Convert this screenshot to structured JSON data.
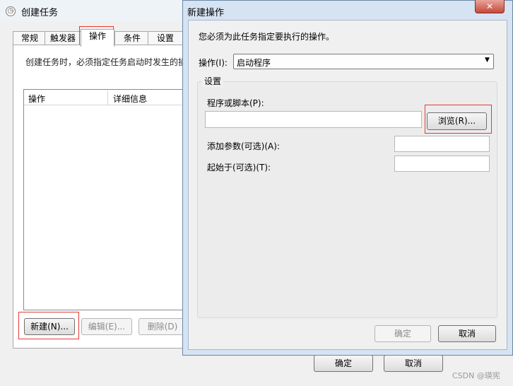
{
  "background_window": {
    "title": "创建任务",
    "tabs": [
      "常规",
      "触发器",
      "操作",
      "条件",
      "设置"
    ],
    "selected_tab": "操作",
    "description": "创建任务时，必须指定任务启动时发生的操",
    "list_columns": [
      "操作",
      "详细信息"
    ],
    "buttons": {
      "new": "新建(N)...",
      "edit": "编辑(E)...",
      "delete": "删除(D)"
    },
    "footer": {
      "ok": "确定",
      "cancel": "取消"
    }
  },
  "dialog": {
    "title": "新建操作",
    "close_glyph": "✕",
    "instruction": "您必须为此任务指定要执行的操作。",
    "action_label": "操作(I):",
    "action_value": "启动程序",
    "settings_group": "设置",
    "program_label": "程序或脚本(P):",
    "program_value": "",
    "browse_button": "浏览(R)...",
    "args_label": "添加参数(可选)(A):",
    "args_value": "",
    "start_in_label": "起始于(可选)(T):",
    "start_in_value": "",
    "ok_button": "确定",
    "cancel_button": "取消"
  },
  "watermark": "CSDN @瑛宪",
  "colors": {
    "highlight": "#e53935",
    "title_bar": "#d6e3f2",
    "close_button": "#c44a3a"
  }
}
